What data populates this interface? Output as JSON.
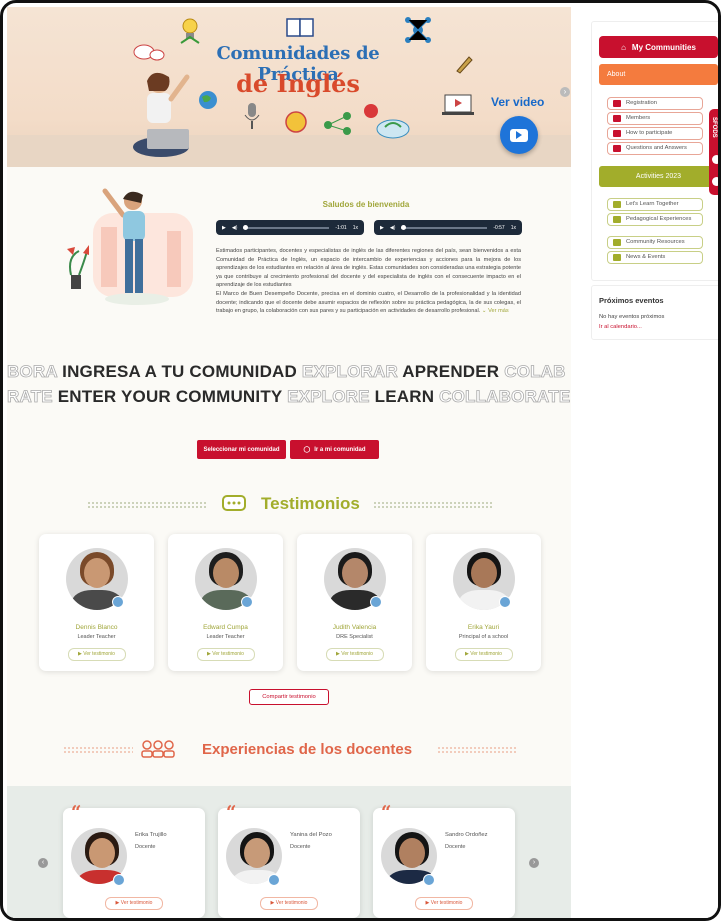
{
  "banner": {
    "title_line1": "Comunidades de Práctica",
    "title_line2": "de Inglés",
    "video_label": "Ver video"
  },
  "welcome": {
    "title": "Saludos de bienvenida",
    "audio1_time": "-1:01",
    "audio1_speed": "1x",
    "audio2_time": "-0:57",
    "audio2_speed": "1x",
    "paragraph1": "Estimados participantes, docentes y especialistas de inglés de las diferentes regiones del país, sean bienvenidos a esta Comunidad de Práctica de Inglés, un espacio de intercambio de experiencias y acciones para la mejora de los aprendizajes de los estudiantes en relación al área de inglés. Estas comunidades son consideradas una estrategia potente ya que contribuye al crecimiento profesional del docente y del especialista de inglés con el consecuente impacto en el aprendizaje de los estudiantes",
    "paragraph2": "El Marco de Buen Desempeño Docente, precisa en el dominio cuatro, el Desarrollo de la profesionalidad y la identidad docente; indicando que el docente debe asumir espacios de reflexión sobre su práctica pedagógica, la de sus colegas, el trabajo en grupo, la colaboración con sus pares y su participación en actividades de desarrollo profesional.",
    "ver_mas": "Ver más"
  },
  "marquee": {
    "line1": [
      {
        "text": "BORA ",
        "style": "outline"
      },
      {
        "text": "INGRESA A TU COMUNIDAD ",
        "style": "dark"
      },
      {
        "text": "EXPLORAR ",
        "style": "outline"
      },
      {
        "text": "APRENDER ",
        "style": "dark"
      },
      {
        "text": "COLAB",
        "style": "outline"
      }
    ],
    "line2": [
      {
        "text": "RATE ",
        "style": "outline"
      },
      {
        "text": "ENTER YOUR COMMUNITY ",
        "style": "dark"
      },
      {
        "text": "EXPLORE ",
        "style": "outline"
      },
      {
        "text": "LEARN ",
        "style": "dark"
      },
      {
        "text": "COLLABORATE",
        "style": "outline"
      }
    ]
  },
  "actions": {
    "select_label": "Seleccionar mi comunidad",
    "go_label": "Ir a mi comunidad"
  },
  "testimonios": {
    "title": "Testimonios",
    "button_label": "Ver testimonio",
    "share_label": "Compartir testimonio",
    "people": [
      {
        "name": "Dennis Blanco",
        "role": "Leader Teacher"
      },
      {
        "name": "Edward Cumpa",
        "role": "Leader Teacher"
      },
      {
        "name": "Judith Valencia",
        "role": "DRE Specialist"
      },
      {
        "name": "Erika Yauri",
        "role": "Principal of a school"
      }
    ]
  },
  "experiencias": {
    "title": "Experiencias de los docentes",
    "button_label": "Ver testimonio",
    "people": [
      {
        "name": "Erika Trujillo",
        "role": "Docente"
      },
      {
        "name": "Yanina del Pozo",
        "role": "Docente"
      },
      {
        "name": "Sandro Ordoñez",
        "role": "Docente"
      }
    ]
  },
  "sidebar": {
    "my_communities": "My Communities",
    "about": "About",
    "about_items": [
      "Registration",
      "Members",
      "How to participate",
      "Questions and Answers"
    ],
    "activities": "Activities 2023",
    "activity_items": [
      "Let's Learn Together",
      "Pedagogical Experiences",
      "Community Resources",
      "News & Events"
    ],
    "events_title": "Próximos eventos",
    "events_none": "No hay eventos próximos",
    "events_link": "Ir al calendario...",
    "sfods": "SFODS"
  },
  "colors": {
    "brand_red": "#c8102e",
    "orange": "#f47b3e",
    "olive": "#a2ad2b",
    "title_blue": "#2c6fb5"
  }
}
